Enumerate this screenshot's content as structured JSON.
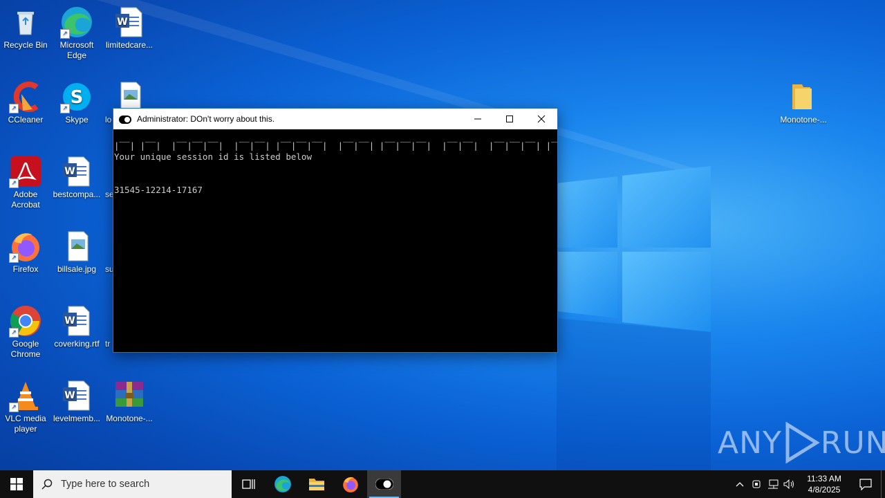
{
  "desktop": {
    "icons": [
      {
        "label": "Recycle Bin",
        "icon": "recycle-bin-icon"
      },
      {
        "label": "Microsoft Edge",
        "icon": "edge-icon"
      },
      {
        "label": "limitedcare...",
        "icon": "word-doc-icon"
      },
      {
        "label": "CCleaner",
        "icon": "ccleaner-icon"
      },
      {
        "label": "Skype",
        "icon": "skype-icon"
      },
      {
        "label": "lo",
        "icon": "image-file-icon"
      },
      {
        "label": "Adobe Acrobat",
        "icon": "acrobat-icon"
      },
      {
        "label": "bestcompa...",
        "icon": "word-doc-icon"
      },
      {
        "label": "se",
        "icon": "file-icon"
      },
      {
        "label": "Firefox",
        "icon": "firefox-icon"
      },
      {
        "label": "billsale.jpg",
        "icon": "image-file-icon"
      },
      {
        "label": "su",
        "icon": "file-icon"
      },
      {
        "label": "Google Chrome",
        "icon": "chrome-icon"
      },
      {
        "label": "coverking.rtf",
        "icon": "word-doc-icon"
      },
      {
        "label": "tr",
        "icon": "file-icon"
      },
      {
        "label": "VLC media player",
        "icon": "vlc-icon"
      },
      {
        "label": "levelmemb...",
        "icon": "word-doc-icon"
      },
      {
        "label": "Monotone-...",
        "icon": "winrar-archive-icon"
      },
      {
        "label": "Monotone-...",
        "icon": "folder-icon"
      }
    ]
  },
  "console": {
    "title": "Administrator:  DOn't worry about this.",
    "banner": "|‾‾| |‾‾|  |‾‾|‾‾|‾‾|  |‾‾|‾‾| |‾‾|‾‾|‾‾|  |‾‾|‾‾| |‾‾|‾‾|‾‾|  |‾‾|‾‾|  |‾‾|‾‾|‾‾| |‾‾|",
    "line1": "Your unique session id is listed below",
    "session_id": "31545-12214-17167"
  },
  "taskbar": {
    "search_placeholder": "Type here to search",
    "time": "11:33 AM",
    "date": "4/8/2025"
  },
  "watermark": {
    "left": "ANY",
    "right": "RUN"
  }
}
